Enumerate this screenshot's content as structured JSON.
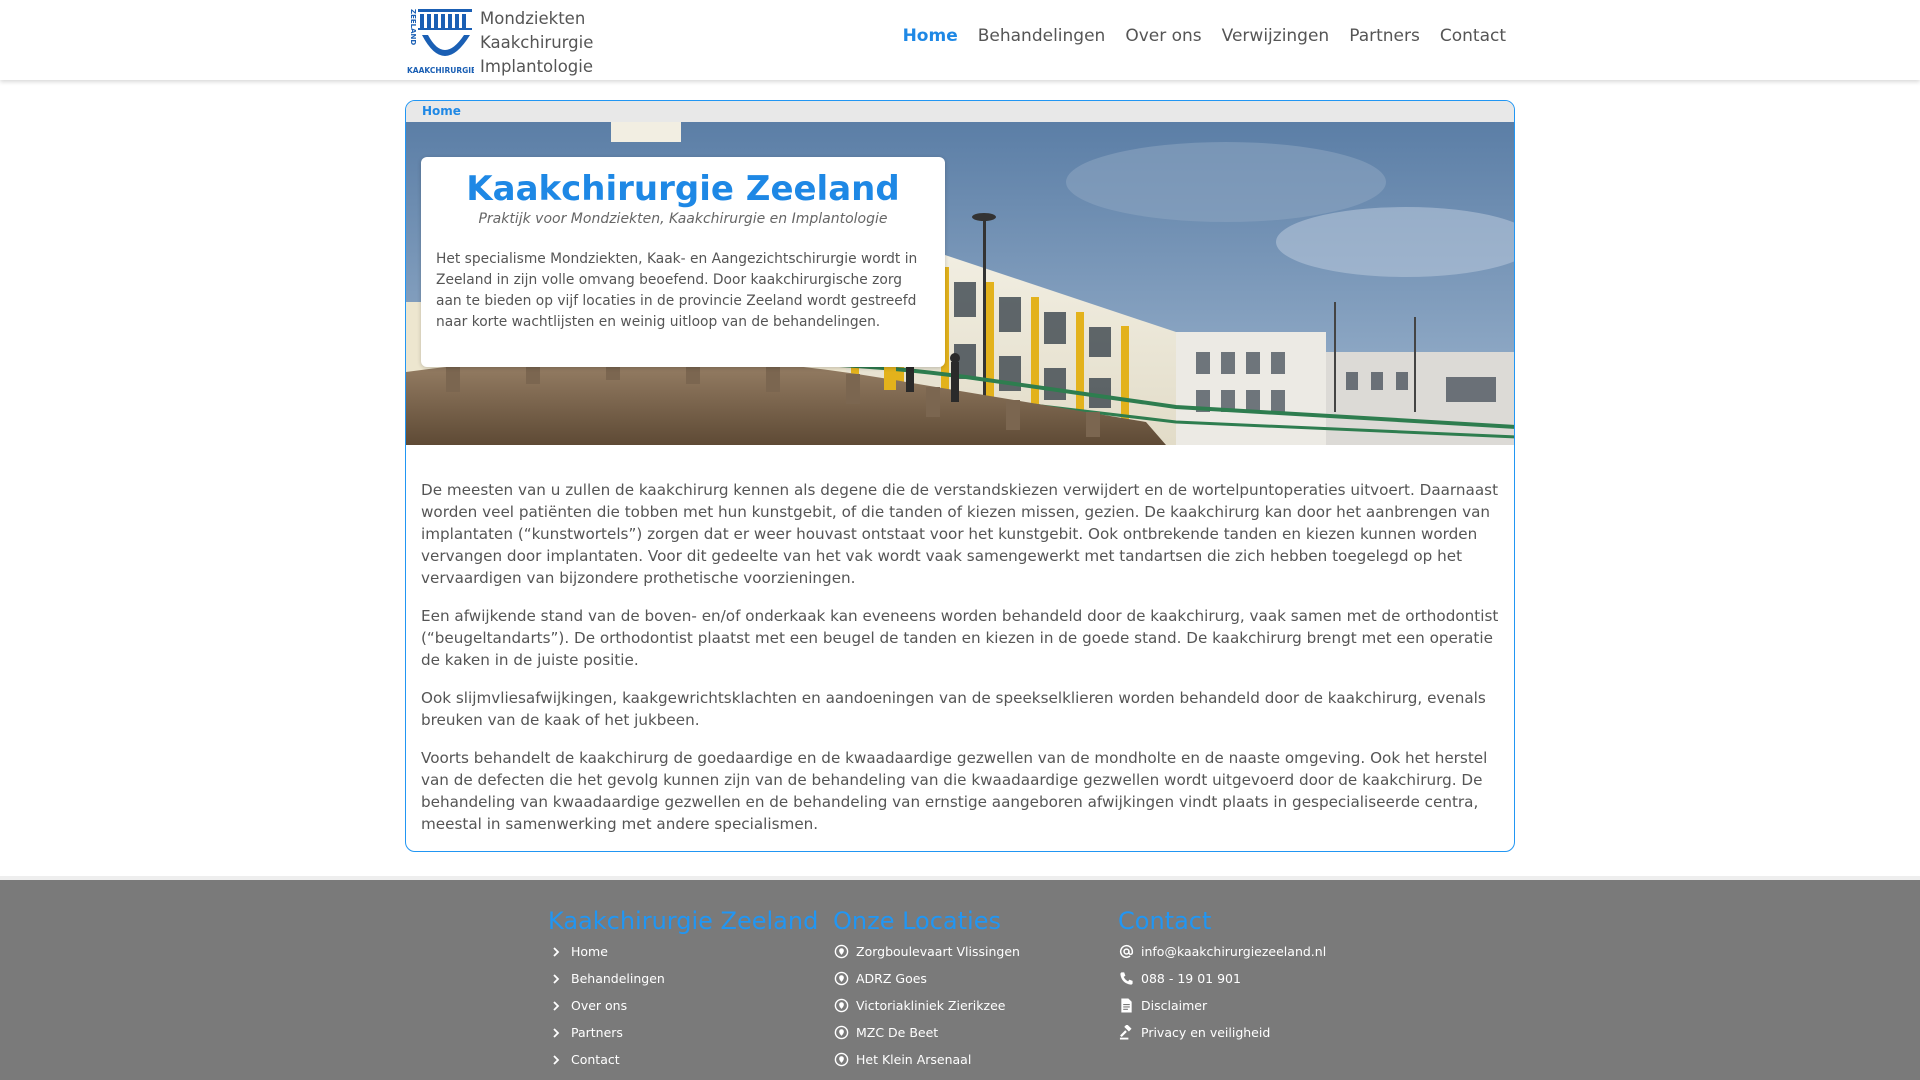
{
  "header": {
    "logo_label": "KAAKCHIRURGIE",
    "logo_side": "ZEELAND",
    "brand_lines": [
      "Mondziekten",
      "Kaakchirurgie",
      "Implantologie"
    ],
    "nav": [
      {
        "label": "Home",
        "active": true
      },
      {
        "label": "Behandelingen",
        "active": false
      },
      {
        "label": "Over ons",
        "active": false
      },
      {
        "label": "Verwijzingen",
        "active": false
      },
      {
        "label": "Partners",
        "active": false
      },
      {
        "label": "Contact",
        "active": false
      }
    ]
  },
  "breadcrumb": "Home",
  "intro": {
    "title": "Kaakchirurgie Zeeland",
    "subtitle": "Praktijk voor Mondziekten, Kaakchirurgie en Implantologie",
    "text": "Het specialisme Mondziekten, Kaak- en Aangezichtschirurgie wordt in Zeeland in zijn volle omvang beoefend. Door kaakchirurgische zorg aan te bieden op vijf locaties in de provincie Zeeland wordt gestreefd naar korte wachtlijsten en weinig uitloop van de behandelingen."
  },
  "content": {
    "paragraphs": [
      "De meesten van u zullen de kaakchirurg kennen als degene die de verstandskiezen verwijdert en de wortelpuntoperaties uitvoert. Daarnaast worden veel patiënten die tobben met hun kunstgebit, of die tanden of kiezen missen, gezien. De kaakchirurg kan door het aanbrengen van implantaten (“kunstwortels”) zorgen dat er weer houvast ontstaat voor het kunstgebit. Ook ontbrekende tanden en kiezen kunnen worden vervangen door implantaten. Voor dit gedeelte van het vak wordt vaak samengewerkt met tandartsen die zich hebben toegelegd op het vervaardigen van bijzondere prothetische voorzieningen.",
      "Een afwijkende stand van de boven- en/of onderkaak kan eveneens worden behandeld door de kaakchirurg, vaak samen met de orthodontist (“beugeltandarts”). De orthodontist plaatst met een beugel de tanden en kiezen in de goede stand. De kaakchirurg brengt met een operatie de kaken in de juiste positie.",
      "Ook slijmvliesafwijkingen, kaakgewrichtsklachten en aandoeningen van de speekselklieren worden behandeld door de kaakchirurg, evenals breuken van de kaak of het jukbeen.",
      "Voorts behandelt de kaakchirurg de goedaardige en de kwaadaardige gezwellen van de mondholte en de naaste omgeving. Ook het herstel van de defecten die het gevolg kunnen zijn van de behandeling van die kwaadaardige gezwellen wordt uitgevoerd door de kaakchirurg. De behandeling van kwaadaardige gezwellen en de behandeling van ernstige aangeboren afwijkingen vindt plaats in gespecialiseerde centra, meestal in samenwerking met andere specialismen."
    ]
  },
  "footer": {
    "col1": {
      "title": "Kaakchirurgie Zeeland",
      "items": [
        {
          "label": "Home",
          "icon": "chevron-right-icon"
        },
        {
          "label": "Behandelingen",
          "icon": "chevron-right-icon"
        },
        {
          "label": "Over ons",
          "icon": "chevron-right-icon"
        },
        {
          "label": "Partners",
          "icon": "chevron-right-icon"
        },
        {
          "label": "Contact",
          "icon": "chevron-right-icon"
        }
      ]
    },
    "col2": {
      "title": "Onze Locaties",
      "items": [
        {
          "label": "Zorgboulevaart Vlissingen",
          "icon": "location-pin-icon"
        },
        {
          "label": "ADRZ Goes",
          "icon": "location-pin-icon"
        },
        {
          "label": "Victoriakliniek Zierikzee",
          "icon": "location-pin-icon"
        },
        {
          "label": "MZC De Beet",
          "icon": "location-pin-icon"
        },
        {
          "label": "Het Klein Arsenaal",
          "icon": "location-pin-icon"
        }
      ]
    },
    "col3": {
      "title": "Contact",
      "items": [
        {
          "label": "info@kaakchirurgiezeeland.nl",
          "icon": "at-sign-icon"
        },
        {
          "label": "088 - 19 01 901",
          "icon": "phone-icon"
        },
        {
          "label": "Disclaimer",
          "icon": "document-icon"
        },
        {
          "label": "Privacy en veiligheid",
          "icon": "gavel-icon"
        }
      ]
    }
  },
  "colors": {
    "accent": "#1e88e5",
    "footer_bg": "#7a7a7a",
    "text": "#555555"
  }
}
